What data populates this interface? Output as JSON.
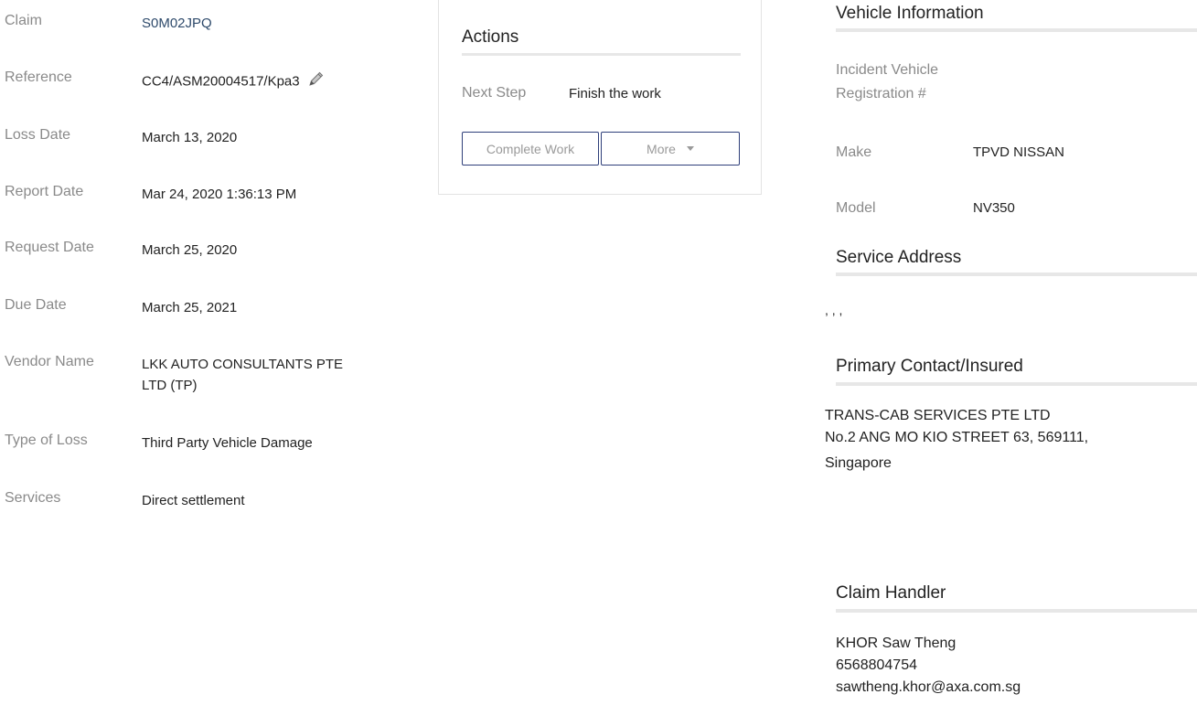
{
  "claim_details": [
    {
      "label": "Claim",
      "value": "S0M02JPQ"
    },
    {
      "label": "Reference",
      "value": "CC4/ASM20004517/Kpa3"
    },
    {
      "label": "Loss Date",
      "value": "March 13, 2020"
    },
    {
      "label": "Report Date",
      "value": "Mar 24, 2020 1:36:13 PM"
    },
    {
      "label": "Request Date",
      "value": "March 25, 2020"
    },
    {
      "label": "Due Date",
      "value": "March 25, 2021"
    },
    {
      "label": "Vendor Name",
      "value": "LKK AUTO CONSULTANTS PTE LTD (TP)"
    },
    {
      "label": "Type of Loss",
      "value": "Third Party Vehicle Damage"
    },
    {
      "label": "Services",
      "value": "Direct settlement"
    }
  ],
  "actions": {
    "title": "Actions",
    "next_step_label": "Next Step",
    "next_step_value": "Finish the work",
    "complete_label": "Complete Work",
    "more_label": "More"
  },
  "vehicle": {
    "title": "Vehicle Information",
    "registration_label": "Incident Vehicle Registration #",
    "registration_value": "",
    "make_label": "Make",
    "make_value": "TPVD NISSAN",
    "model_label": "Model",
    "model_value": "NV350"
  },
  "service_address": {
    "title": "Service Address",
    "value": ", , ,"
  },
  "primary_contact": {
    "title": "Primary Contact/Insured",
    "line1": "TRANS-CAB SERVICES PTE LTD",
    "line2": "No.2 ANG MO KIO STREET 63, 569111,",
    "line3": "Singapore"
  },
  "claim_handler": {
    "title": "Claim Handler",
    "name": "KHOR Saw Theng",
    "phone": "6568804754",
    "email": "sawtheng.khor@axa.com.sg"
  },
  "colors": {
    "link": "#2e4a6b",
    "button_border": "#2f3f7a",
    "label": "#8a8a8a",
    "rule": "#e7e7e7"
  },
  "icons": {
    "edit": "pencil-icon",
    "more": "caret-down-icon"
  }
}
